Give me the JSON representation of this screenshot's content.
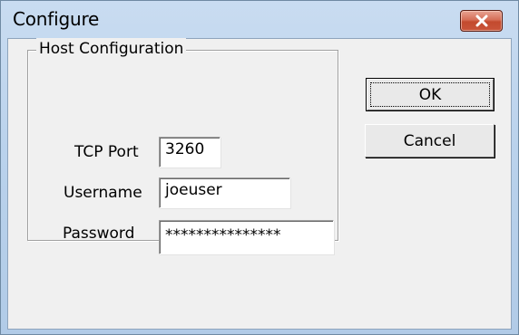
{
  "window": {
    "title": "Configure",
    "close_icon": "close-icon"
  },
  "group": {
    "label": "Host Configuration"
  },
  "fields": {
    "tcp_port": {
      "label": "TCP Port",
      "value": "3260"
    },
    "username": {
      "label": "Username",
      "value": "joeuser"
    },
    "password": {
      "label": "Password",
      "value": "***************"
    }
  },
  "buttons": {
    "ok": "OK",
    "cancel": "Cancel"
  },
  "colors": {
    "titlebar": "#bad2ec",
    "close_button": "#c9543a",
    "client_bg": "#f0f0f0"
  }
}
